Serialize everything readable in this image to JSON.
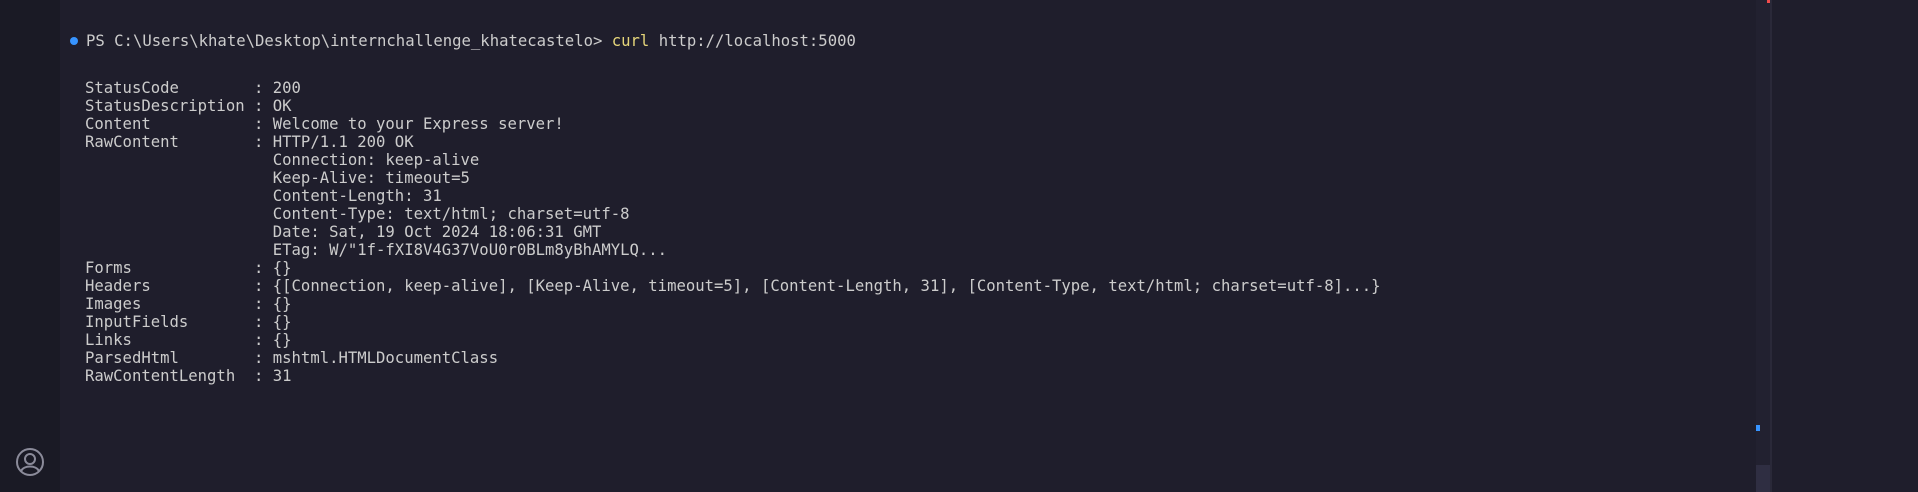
{
  "prompt": {
    "path": "PS C:\\Users\\khate\\Desktop\\internchallenge_khatecastelo> ",
    "command": "curl",
    "args": " http://localhost:5000"
  },
  "output": [
    "StatusCode        : 200",
    "StatusDescription : OK",
    "Content           : Welcome to your Express server!",
    "RawContent        : HTTP/1.1 200 OK",
    "                    Connection: keep-alive",
    "                    Keep-Alive: timeout=5",
    "                    Content-Length: 31",
    "                    Content-Type: text/html; charset=utf-8",
    "                    Date: Sat, 19 Oct 2024 18:06:31 GMT",
    "                    ETag: W/\"1f-fXI8V4G37VoU0r0BLm8yBhAMYLQ...",
    "Forms             : {}",
    "Headers           : {[Connection, keep-alive], [Keep-Alive, timeout=5], [Content-Length, 31], [Content-Type, text/html; charset=utf-8]...}",
    "Images            : {}",
    "InputFields       : {}",
    "Links             : {}",
    "ParsedHtml        : mshtml.HTMLDocumentClass",
    "RawContentLength  : 31"
  ],
  "icons": {
    "account": "account-icon",
    "command_status": "command-status-dot-icon"
  },
  "colors": {
    "background": "#1f1e2c",
    "text": "#cccccc",
    "command": "#e5d57a",
    "status_dot": "#3794ff"
  }
}
